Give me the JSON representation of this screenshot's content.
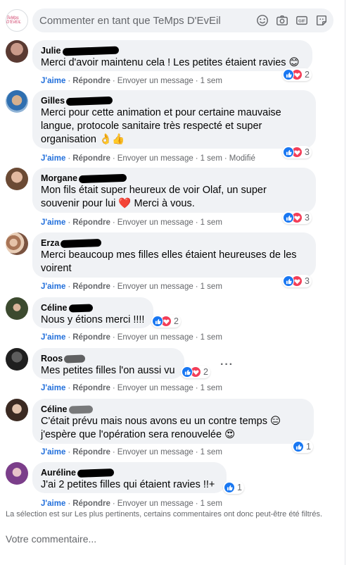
{
  "composer": {
    "placeholder": "Commenter en tant que TeMps D'EvEil",
    "avatar_label": "TeMps D'EvEiL",
    "icons": [
      "smiley-icon",
      "camera-icon",
      "gif-icon",
      "sticker-icon"
    ],
    "gif_label": "GIF"
  },
  "actions": {
    "like": "J'aime",
    "reply": "Répondre",
    "message": "Envoyer un message",
    "dot": "·"
  },
  "comments": [
    {
      "author": "Julie",
      "text": "Merci d'avoir maintenu cela ! Les petites étaient ravies 😊",
      "time": "1 sem",
      "reactions": {
        "like": true,
        "love": true,
        "count": "2"
      }
    },
    {
      "author": "Gilles",
      "text": "Merci pour cette animation et pour certaine mauvaise langue, protocole sanitaire très respecté et super organisation 👌👍",
      "time": "1 sem",
      "edited": "Modifié",
      "reactions": {
        "like": true,
        "love": true,
        "count": "3"
      }
    },
    {
      "author": "Morgane",
      "text": "Mon fils était super heureux de voir Olaf, un super souvenir pour lui ❤️ Merci à vous.",
      "time": "1 sem",
      "reactions": {
        "like": true,
        "love": true,
        "count": "3"
      }
    },
    {
      "author": "Erza",
      "text": "Merci beaucoup mes filles elles étaient heureuses de les voirent",
      "time": "1 sem",
      "reactions": {
        "like": true,
        "love": true,
        "count": "3"
      }
    },
    {
      "author": "Céline",
      "text": "Nous y étions merci !!!!",
      "time": "1 sem",
      "reactions": {
        "like": true,
        "love": true,
        "count": "2"
      }
    },
    {
      "author": "Roos",
      "text": "Mes petites filles l'on aussi vu",
      "time": "1 sem",
      "reactions": {
        "like": true,
        "love": true,
        "count": "2"
      }
    },
    {
      "author": "Céline",
      "text": "C'était prévu mais nous avons eu un contre temps 😑 j'espère que l'opération sera renouvelée 😍",
      "time": "1 sem",
      "reactions": {
        "like": true,
        "love": false,
        "count": "1"
      }
    },
    {
      "author": "Auréline",
      "text": "J'ai 2 petites filles qui étaient ravies !!+",
      "time": "1 sem",
      "reactions": {
        "like": true,
        "love": false,
        "count": "1"
      }
    }
  ],
  "more_options": "···",
  "footer_note": "La sélection est sur Les plus pertinents, certains commentaires ont donc peut-être été filtrés.",
  "your_comment": "Votre commentaire..."
}
